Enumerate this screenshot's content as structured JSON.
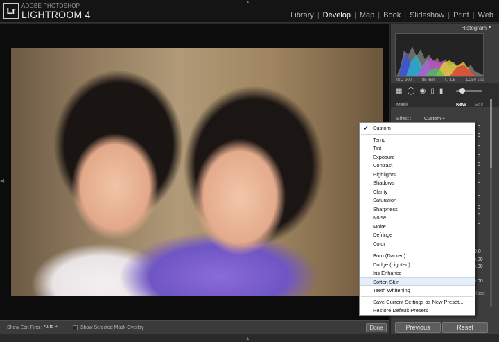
{
  "app": {
    "logo": "Lr",
    "brand_sub": "ADOBE PHOTOSHOP",
    "brand_main": "LIGHTROOM 4"
  },
  "modules": [
    {
      "label": "Library",
      "active": false
    },
    {
      "label": "Develop",
      "active": true
    },
    {
      "label": "Map",
      "active": false
    },
    {
      "label": "Book",
      "active": false
    },
    {
      "label": "Slideshow",
      "active": false
    },
    {
      "label": "Print",
      "active": false
    },
    {
      "label": "Web",
      "active": false
    }
  ],
  "histogram": {
    "title": "Histogram",
    "iso": "ISO 200",
    "focal": "85 mm",
    "aperture": "f / 1.8",
    "shutter": "1/250 sec"
  },
  "mask": {
    "label": "Mask :",
    "new": "New",
    "edit": "Edit"
  },
  "effect": {
    "label": "Effect :",
    "value": "Custom ÷"
  },
  "slider_values": [
    "0",
    "0",
    "0",
    "0",
    "0",
    "0",
    "0",
    "0",
    "0",
    "0",
    "0",
    "0.0",
    "0.00",
    "0.00",
    "0.00"
  ],
  "close_label": "Close",
  "toolbar": {
    "show_pins_label": "Show Edit Pins :",
    "show_pins_value": "Auto ÷",
    "overlay_label": "Show Selected Mask Overlay",
    "done_label": "Done"
  },
  "panel_buttons": {
    "previous": "Previous",
    "reset": "Reset"
  },
  "menu": {
    "selected_value": "Custom",
    "groups": [
      [
        "Custom"
      ],
      [
        "Temp",
        "Tint",
        "Exposure",
        "Contrast",
        "Highlights",
        "Shadows",
        "Clarity",
        "Saturation",
        "Sharpness",
        "Noise",
        "Moiré",
        "Defringe",
        "Color"
      ],
      [
        "Burn (Darken)",
        "Dodge (Lighten)",
        "Iris Enhance",
        "Soften Skin",
        "Teeth Whitening"
      ],
      [
        "Save Current Settings as New Preset...",
        "Restore Default Presets"
      ]
    ],
    "highlighted": "Soften Skin"
  },
  "colors": {
    "top_bar": "#141414",
    "panel": "#3d3d3d",
    "menu_bg": "#ffffff",
    "menu_highlight": "#e5eef9"
  }
}
